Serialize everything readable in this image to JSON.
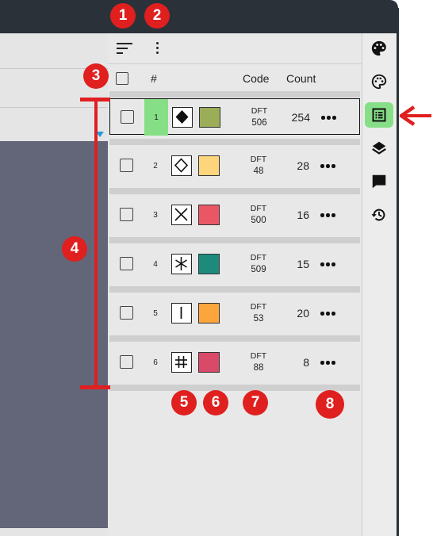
{
  "toolbar": {
    "sort_icon": "sort-lines-icon",
    "more_icon": "kebab-menu-icon"
  },
  "header": {
    "index": "#",
    "code": "Code",
    "count": "Count"
  },
  "rows": [
    {
      "index": "1",
      "symbol": "filled-diamond",
      "color": "#9bad58",
      "code_prefix": "DFT",
      "code_number": "506",
      "count": "254",
      "selected": true
    },
    {
      "index": "2",
      "symbol": "open-diamond",
      "color": "#fdd57d",
      "code_prefix": "DFT",
      "code_number": "48",
      "count": "28",
      "selected": false
    },
    {
      "index": "3",
      "symbol": "x-cross",
      "color": "#ea5663",
      "code_prefix": "DFT",
      "code_number": "500",
      "count": "16",
      "selected": false
    },
    {
      "index": "4",
      "symbol": "asterisk",
      "color": "#1d8a7c",
      "code_prefix": "DFT",
      "code_number": "509",
      "count": "15",
      "selected": false
    },
    {
      "index": "5",
      "symbol": "vertical-bar",
      "color": "#fba53c",
      "code_prefix": "DFT",
      "code_number": "53",
      "count": "20",
      "selected": false
    },
    {
      "index": "6",
      "symbol": "hash",
      "color": "#d84a68",
      "code_prefix": "DFT",
      "code_number": "88",
      "count": "8",
      "selected": false
    }
  ],
  "sidebar": {
    "items": [
      {
        "name": "palette-filled-icon",
        "active": false
      },
      {
        "name": "palette-outline-icon",
        "active": false
      },
      {
        "name": "list-icon",
        "active": true
      },
      {
        "name": "layers-icon",
        "active": false
      },
      {
        "name": "comment-icon",
        "active": false
      },
      {
        "name": "history-icon",
        "active": false
      }
    ]
  },
  "annotations": {
    "badges": [
      "1",
      "2",
      "3",
      "4",
      "5",
      "6",
      "7",
      "8"
    ],
    "color": "#e01f1f"
  }
}
